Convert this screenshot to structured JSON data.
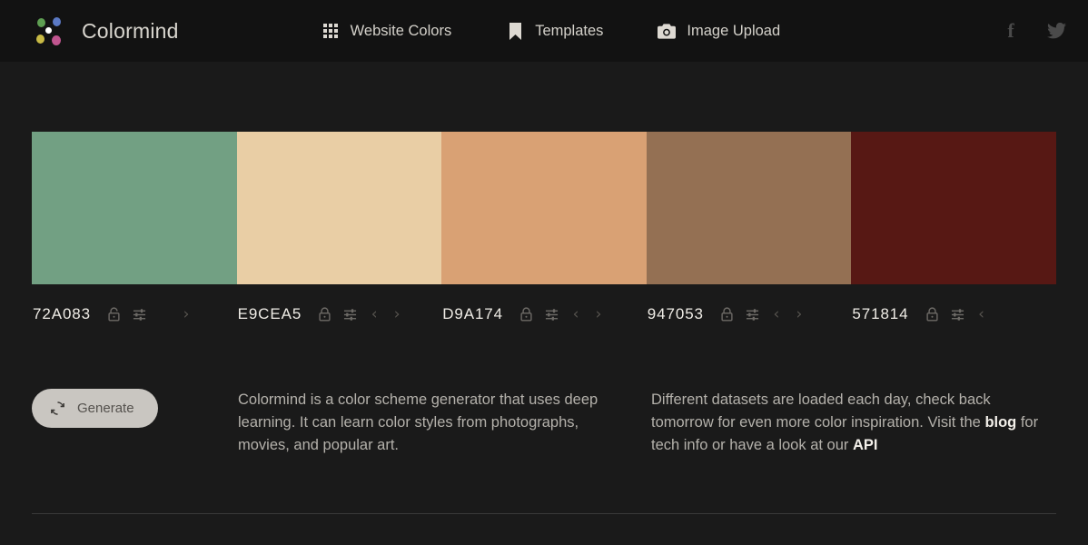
{
  "header": {
    "brand": "Colormind",
    "logo_icon": "colormind-dots-logo",
    "nav": [
      {
        "label": "Website Colors",
        "icon": "grid-icon"
      },
      {
        "label": "Templates",
        "icon": "bookmark-icon"
      },
      {
        "label": "Image Upload",
        "icon": "camera-icon"
      }
    ],
    "social": [
      {
        "name": "facebook-icon",
        "glyph": "f"
      },
      {
        "name": "twitter-icon",
        "glyph": ""
      }
    ]
  },
  "palette": {
    "swatches": [
      {
        "hex": "72A083",
        "color": "#72A083",
        "locked": false,
        "has_prev": false,
        "has_next": true
      },
      {
        "hex": "E9CEA5",
        "color": "#E9CEA5",
        "locked": true,
        "has_prev": true,
        "has_next": true
      },
      {
        "hex": "D9A174",
        "color": "#D9A174",
        "locked": true,
        "has_prev": true,
        "has_next": true
      },
      {
        "hex": "947053",
        "color": "#947053",
        "locked": true,
        "has_prev": true,
        "has_next": true
      },
      {
        "hex": "571814",
        "color": "#571814",
        "locked": true,
        "has_prev": true,
        "has_next": false
      }
    ]
  },
  "actions": {
    "generate_label": "Generate",
    "generate_icon": "refresh-icon"
  },
  "info": {
    "paragraph1": "Colormind is a color scheme generator that uses deep learning. It can learn color styles from photographs, movies, and popular art.",
    "paragraph2_part1": "Different datasets are loaded each day, check back tomorrow for even more color inspiration. Visit the ",
    "paragraph2_link1": "blog",
    "paragraph2_part2": " for tech info or have a look at our ",
    "paragraph2_link2": "API"
  }
}
